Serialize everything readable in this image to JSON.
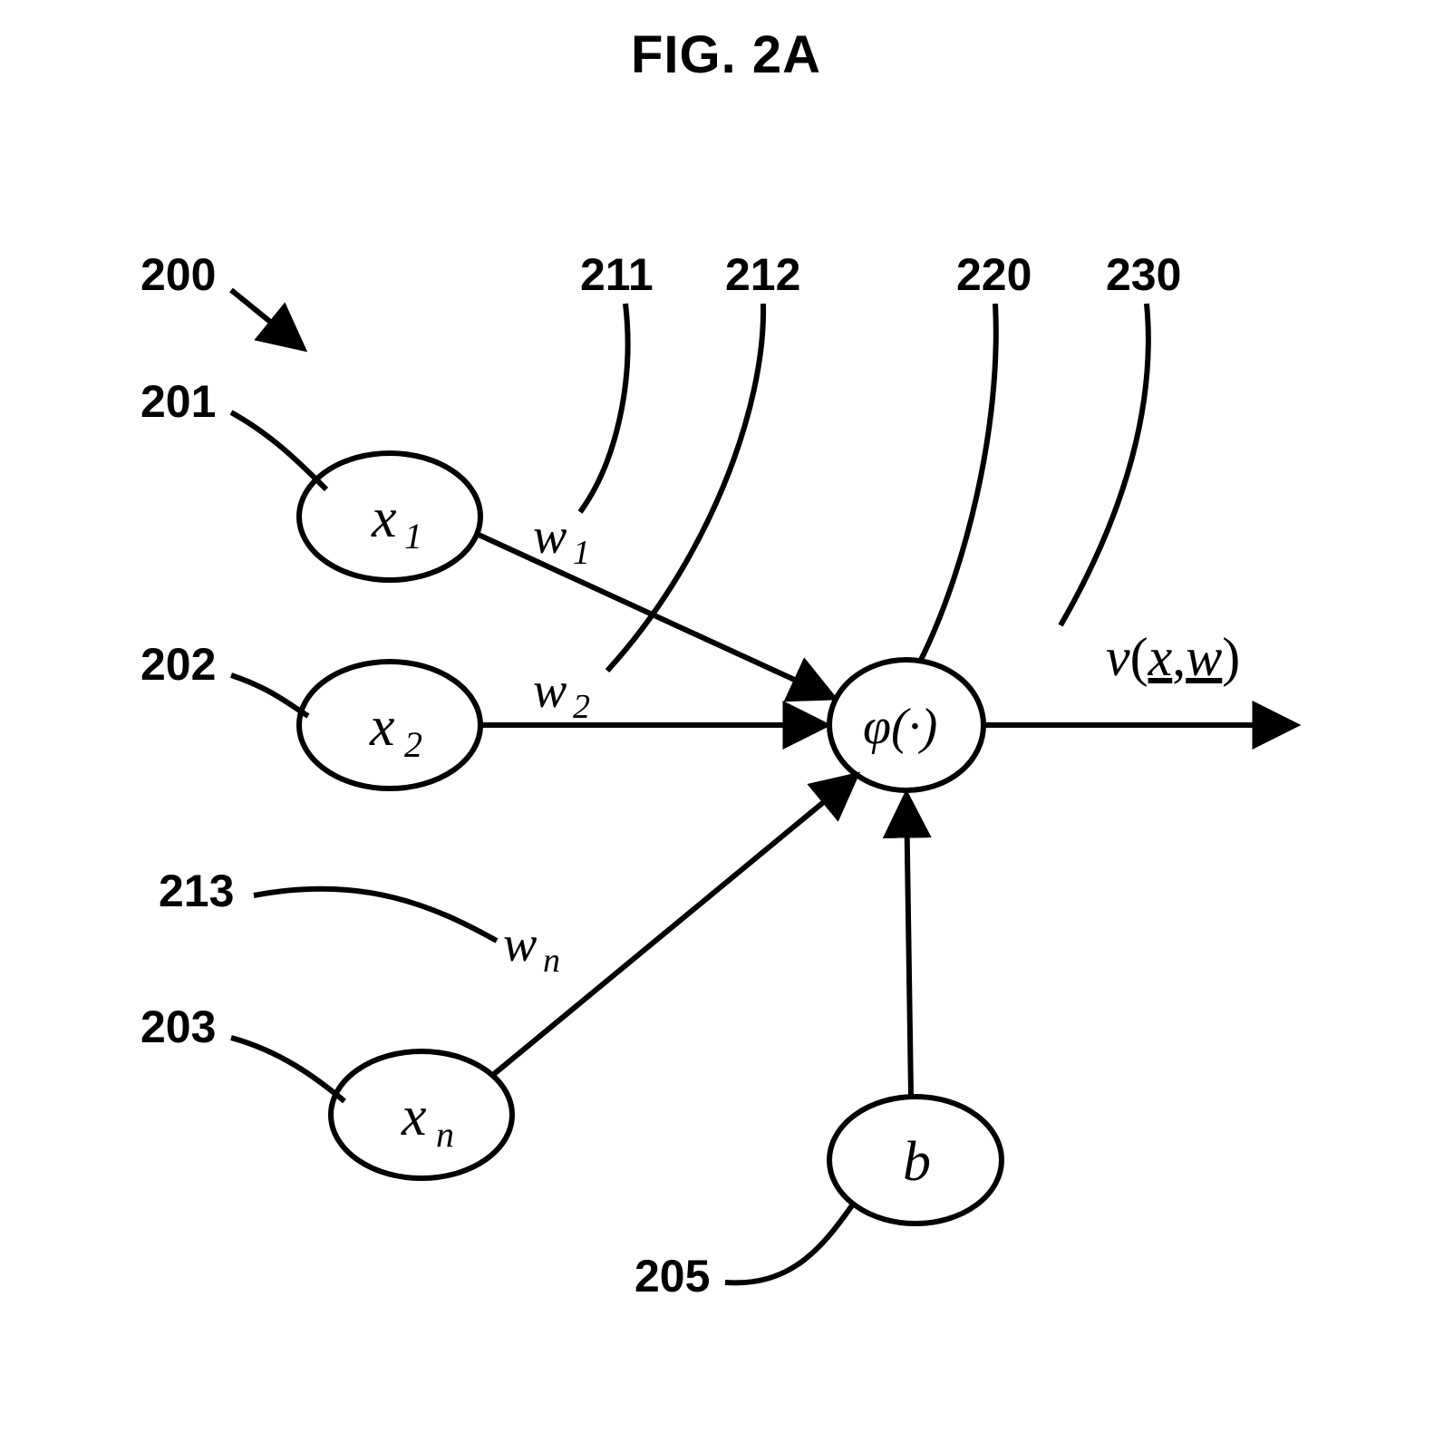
{
  "figure_title": "FIG. 2A",
  "refs": {
    "r200": "200",
    "r201": "201",
    "r202": "202",
    "r203": "203",
    "r205": "205",
    "r211": "211",
    "r212": "212",
    "r213": "213",
    "r220": "220",
    "r230": "230"
  },
  "nodes": {
    "x1": {
      "base": "x",
      "sub": "1"
    },
    "x2": {
      "base": "x",
      "sub": "2"
    },
    "xn": {
      "base": "x",
      "sub": "n"
    },
    "b": {
      "base": "b"
    },
    "phi": {
      "text": "φ(·)"
    }
  },
  "weights": {
    "w1": {
      "base": "w",
      "sub": "1"
    },
    "w2": {
      "base": "w",
      "sub": "2"
    },
    "wn": {
      "base": "w",
      "sub": "n"
    }
  },
  "output": {
    "v": "v",
    "open": "(",
    "x": "x",
    "comma": ",",
    "w": "w",
    "close": ")"
  }
}
